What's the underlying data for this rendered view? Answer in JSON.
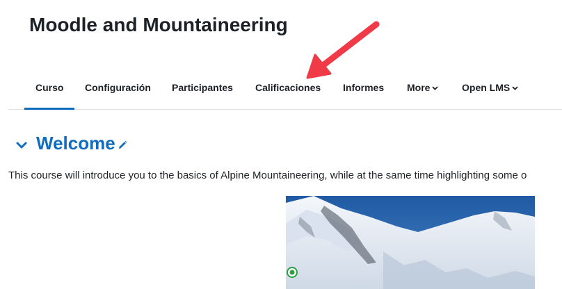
{
  "header": {
    "course_title": "Moodle and Mountaineering"
  },
  "nav": {
    "items": [
      {
        "label": "Curso",
        "active": true
      },
      {
        "label": "Configuración"
      },
      {
        "label": "Participantes"
      },
      {
        "label": "Calificaciones"
      },
      {
        "label": "Informes"
      },
      {
        "label": "More",
        "dropdown": true
      },
      {
        "label": "Open LMS",
        "dropdown": true
      }
    ]
  },
  "section": {
    "title": "Welcome",
    "collapse_icon": "chevron-down-icon",
    "edit_icon": "pencil-icon",
    "summary": "This course will introduce you to the basics of Alpine Mountaineering, while at the same time highlighting some o"
  },
  "image": {
    "subject": "snowy mountain under blue sky",
    "badge_icon": "green-circle-icon"
  },
  "annotation": {
    "type": "red arrow",
    "points_to": "Calificaciones"
  },
  "colors": {
    "accent": "#0f6cbf",
    "text": "#1d2125",
    "annotation": "#f03a47"
  }
}
